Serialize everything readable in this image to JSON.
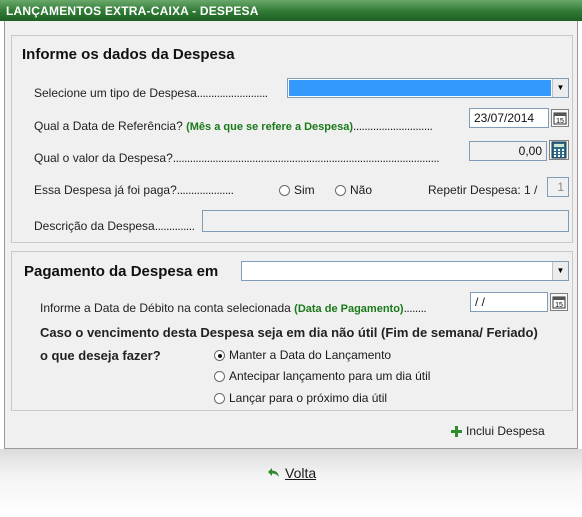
{
  "window": {
    "title": "LANÇAMENTOS EXTRA-CAIXA - DESPESA"
  },
  "despesa": {
    "section_title": "Informe os dados da Despesa",
    "tipo_label": "Selecione um tipo de Despesa",
    "tipo_value": "",
    "data_ref_label": "Qual a Data de Referência?",
    "data_ref_hint": "(Mês a que se refere a Despesa)",
    "data_ref_value": "23/07/2014",
    "valor_label": "Qual o valor da Despesa?",
    "valor_value": "0,00",
    "paga_label": "Essa Despesa já foi paga?",
    "paga_options": [
      "Sim",
      "Não"
    ],
    "repetir_label": "Repetir Despesa: 1 /",
    "repetir_value": "1",
    "descricao_label": "Descrição da Despesa",
    "descricao_value": ""
  },
  "pagamento": {
    "section_title": "Pagamento da Despesa em",
    "conta_value": "",
    "debito_label": "Informe a Data de Débito na conta selecionada",
    "debito_hint": "(Data de Pagamento)",
    "debito_value": " / /",
    "dia_util_question_1": "Caso o vencimento desta Despesa seja em dia não útil (Fim de semana/ Feriado)",
    "dia_util_question_2": "o que deseja fazer?",
    "options": [
      "Manter a Data do Lançamento",
      "Antecipar lançamento para um dia útil",
      "Lançar para o próximo dia útil"
    ],
    "selected_option": 0
  },
  "actions": {
    "incluir_label": "Inclui Despesa",
    "voltar_label": "Volta"
  },
  "colors": {
    "title_green": "#2f7a35",
    "hint_green": "#1a7a1a",
    "selection_blue": "#3399ff"
  }
}
